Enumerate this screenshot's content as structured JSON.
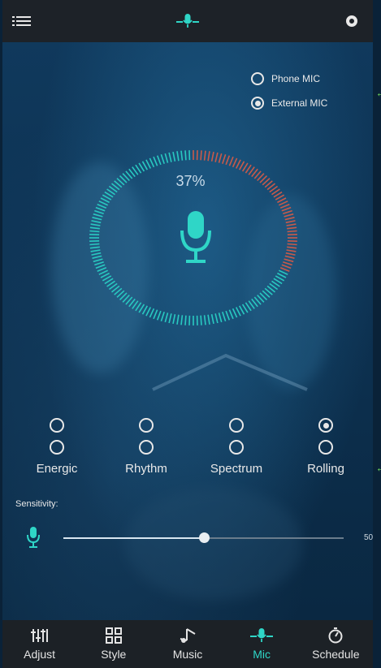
{
  "colors": {
    "accent": "#2fd6c7",
    "gauge_active": "#29c9c1",
    "gauge_inactive": "#c85a4a",
    "annotation_arrow": "#6bd25a"
  },
  "header": {
    "menu_icon": "menu-icon",
    "logo_icon": "mic-logo-icon",
    "settings_icon": "settings-icon"
  },
  "mic_source": {
    "options": [
      {
        "label": "Phone MIC",
        "selected": false
      },
      {
        "label": "External MIC",
        "selected": true
      }
    ]
  },
  "level": {
    "percent_label": "37%",
    "percent": 37
  },
  "modes": {
    "rows": 2,
    "columns": [
      {
        "name": "Energic",
        "row1": false,
        "row2": false
      },
      {
        "name": "Rhythm",
        "row1": false,
        "row2": false
      },
      {
        "name": "Spectrum",
        "row1": false,
        "row2": false
      },
      {
        "name": "Rolling",
        "row1": true,
        "row2": false
      }
    ]
  },
  "sensitivity": {
    "label": "Sensitivity:",
    "value": "50",
    "fraction": 0.5
  },
  "tabs": [
    {
      "label": "Adjust",
      "icon": "equalizer-icon",
      "active": false
    },
    {
      "label": "Style",
      "icon": "grid-icon",
      "active": false
    },
    {
      "label": "Music",
      "icon": "music-icon",
      "active": false
    },
    {
      "label": "Mic",
      "icon": "mic-icon",
      "active": true
    },
    {
      "label": "Schedule",
      "icon": "timer-icon",
      "active": false
    }
  ]
}
